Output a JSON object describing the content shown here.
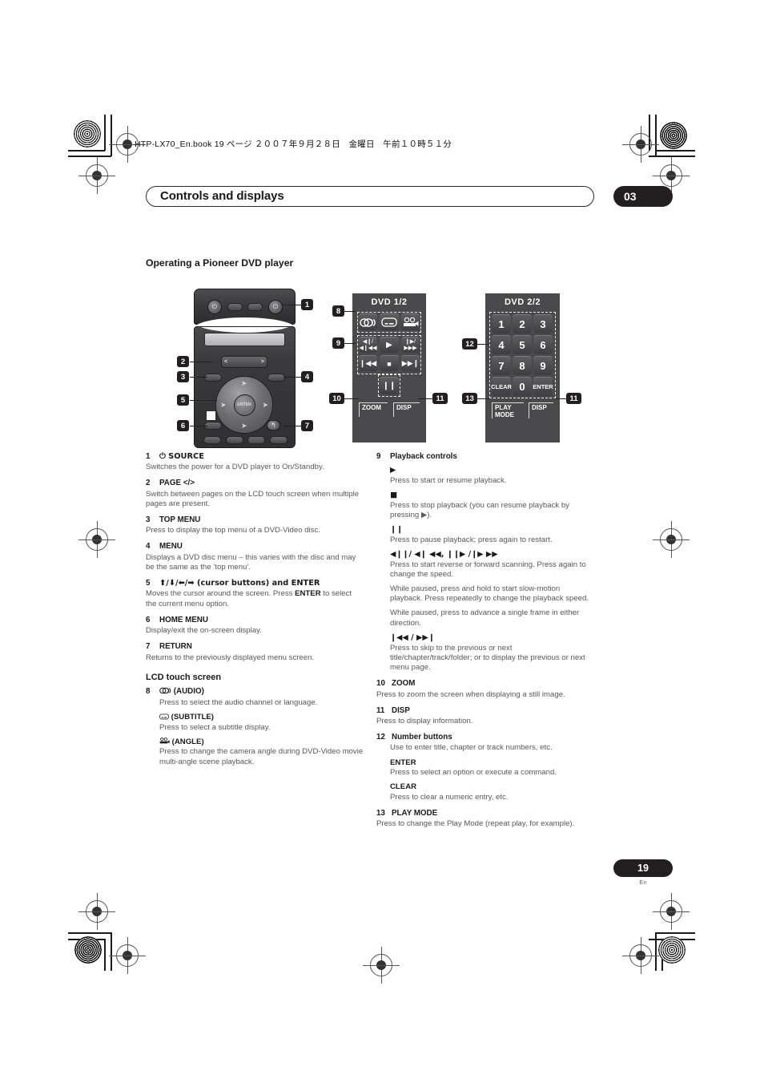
{
  "print_marks": {
    "book_line": "HTP-LX70_En.book  19 ページ  ２００７年９月２８日　金曜日　午前１０時５１分"
  },
  "header": {
    "chapter_title": "Controls and displays",
    "chapter_number": "03"
  },
  "section": {
    "heading": "Operating a Pioneer DVD player"
  },
  "figure": {
    "panel1": {
      "title": "DVD  1/2",
      "function_keys": [
        "audio-icon",
        "subtitle-icon",
        "angle-icon"
      ],
      "transport_keys": [
        "◀❙❙ /\n◀❙◀◀",
        "▶",
        "❙❙▶ /\n▶▶▶",
        "❙◀◀",
        "■",
        "▶▶❙"
      ],
      "pause_key": "❙❙",
      "zoom_key": "ZOOM",
      "disp_key": "DISP"
    },
    "panel2": {
      "title": "DVD  2/2",
      "keys": [
        "1",
        "2",
        "3",
        "4",
        "5",
        "6",
        "7",
        "8",
        "9",
        "CLEAR",
        "0",
        "ENTER"
      ],
      "play_mode_key": "PLAY\nMODE",
      "disp_key": "DISP"
    },
    "callouts": [
      "1",
      "2",
      "3",
      "4",
      "5",
      "6",
      "7",
      "8",
      "9",
      "10",
      "11",
      "12",
      "13",
      "11"
    ],
    "remote_page_rocker": {
      "left": "<",
      "right": ">"
    },
    "remote_enter_label": "ENTER"
  },
  "left_column": {
    "items": [
      {
        "num": "1",
        "label": "⏻ SOURCE",
        "body": [
          "Switches the power for a DVD player to On/Standby."
        ]
      },
      {
        "num": "2",
        "label": "PAGE </>",
        "body": [
          "Switch between pages on the LCD touch screen when multiple pages are present."
        ]
      },
      {
        "num": "3",
        "label": "TOP MENU",
        "body": [
          "Press to display the top menu of a DVD-Video disc."
        ]
      },
      {
        "num": "4",
        "label": "MENU",
        "body": [
          "Displays a DVD disc menu – this varies with the disc and may be the same as the ‘top menu’."
        ]
      },
      {
        "num": "5",
        "label": "⬆/⬇/⬅/➡ (cursor buttons) and ENTER",
        "body": [
          "Moves the cursor around the screen. Press ENTER to select the current menu option."
        ]
      },
      {
        "num": "6",
        "label": "HOME MENU",
        "body": [
          "Display/exit the on-screen display."
        ]
      },
      {
        "num": "7",
        "label": "RETURN",
        "body": [
          "Returns to the previously displayed menu screen."
        ]
      }
    ],
    "group_title": "LCD touch screen",
    "item8": {
      "num": "8",
      "sub_items": [
        {
          "icon": "audio-icon",
          "label": "(AUDIO)",
          "body": "Press to select the audio channel or language."
        },
        {
          "icon": "subtitle-icon",
          "label": "(SUBTITLE)",
          "body": "Press to select a subtitle display."
        },
        {
          "icon": "angle-icon",
          "label": "(ANGLE)",
          "body": "Press to change the camera angle during DVD-Video movie multi-angle scene playback."
        }
      ]
    }
  },
  "right_column": {
    "item9": {
      "num": "9",
      "label": "Playback controls",
      "sub_items": [
        {
          "symbol": "▶",
          "body": [
            "Press to start or resume playback."
          ]
        },
        {
          "symbol": "■",
          "body": [
            "Press to stop playback (you can resume playback by pressing ▶)."
          ]
        },
        {
          "symbol": "❙❙",
          "body": [
            "Press to pause playback; press again to restart."
          ]
        },
        {
          "symbol": "◀❙❙/ ◀❙ ◀◀, ❙❙▶ /❙▶ ▶▶",
          "body": [
            "Press to start reverse or forward scanning. Press again to change the speed.",
            "While paused, press and hold to start slow-motion playback. Press repeatedly to change the playback speed.",
            "While paused, press to advance a single frame in either direction."
          ]
        },
        {
          "symbol": "❙◀◀ / ▶▶❙",
          "body": [
            "Press to skip to the previous or next title/chapter/track/folder; or to display the previous or next menu page."
          ]
        }
      ]
    },
    "items": [
      {
        "num": "10",
        "label": "ZOOM",
        "body": [
          "Press to zoom the screen when displaying a still image."
        ]
      },
      {
        "num": "11",
        "label": "DISP",
        "body": [
          "Press to display information."
        ]
      }
    ],
    "item12": {
      "num": "12",
      "label": "Number buttons",
      "body": "Use to enter title, chapter or track numbers, etc.",
      "sub_items": [
        {
          "label": "ENTER",
          "body": "Press to select an option or execute a command."
        },
        {
          "label": "CLEAR",
          "body": "Press to clear a numeric entry, etc."
        }
      ]
    },
    "item13": {
      "num": "13",
      "label": "PLAY MODE",
      "body": [
        "Press to change the Play Mode (repeat play, for example)."
      ]
    }
  },
  "footer": {
    "page_number": "19",
    "language": "En"
  }
}
